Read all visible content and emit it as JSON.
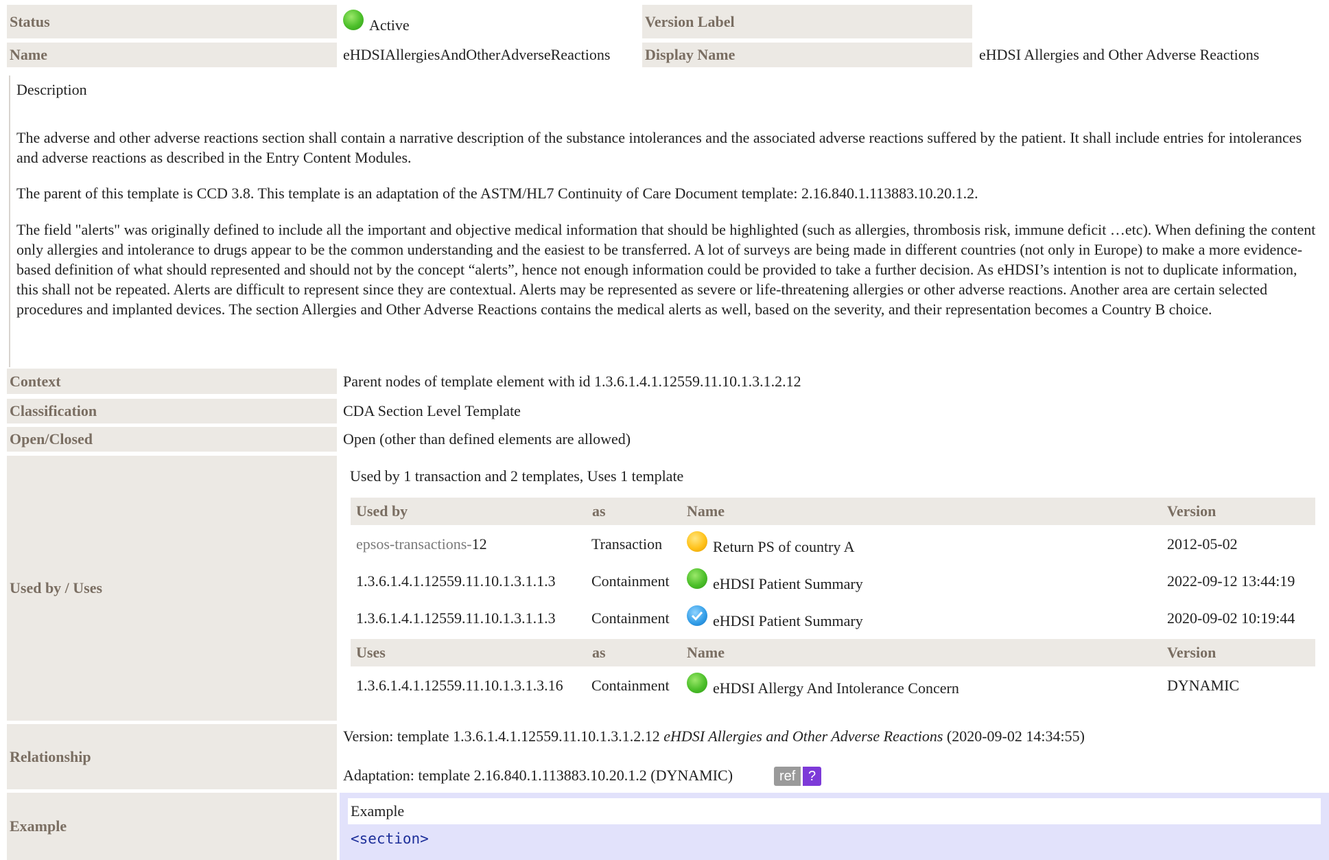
{
  "header": {
    "status_label": "Status",
    "status_value": "Active",
    "version_label_label": "Version Label",
    "version_label_value": "",
    "name_label": "Name",
    "name_value": "eHDSIAllergiesAndOtherAdverseReactions",
    "display_name_label": "Display Name",
    "display_name_value": "eHDSI Allergies and Other Adverse Reactions"
  },
  "description": {
    "title": "Description",
    "paragraphs": [
      "The adverse and other adverse reactions section shall contain a narrative description of the substance intolerances and the associated adverse reactions suffered by the patient. It shall include entries for intolerances and adverse reactions as described in the Entry Content Modules.",
      "The parent of this template is CCD 3.8. This template is an adaptation of the ASTM/HL7 Continuity of Care Document template: 2.16.840.1.113883.10.20.1.2.",
      "The field \"alerts\" was originally defined to include all the important and objective medical information that should be highlighted (such as allergies, thrombosis risk, immune deficit …etc). When defining the content only allergies and intolerance to drugs appear to be the common understanding and the easiest to be transferred. A lot of surveys are being made in different countries (not only in Europe) to make a more evidence-based definition of what should represented and should not by the concept “alerts”, hence not enough information could be provided to take a further decision. As eHDSI’s intention is not to duplicate information, this shall not be repeated. Alerts are difficult to represent since they are contextual. Alerts may be represented as severe or life-threatening allergies or other adverse reactions. Another area are certain selected procedures and implanted devices. The section Allergies and Other Adverse Reactions contains the medical alerts as well, based on the severity, and their representation becomes a Country B choice."
    ]
  },
  "context": {
    "label": "Context",
    "value": "Parent nodes of template element with id 1.3.6.1.4.1.12559.11.10.1.3.1.2.12"
  },
  "classification": {
    "label": "Classification",
    "value": "CDA Section Level Template"
  },
  "open_closed": {
    "label": "Open/Closed",
    "value": "Open (other than defined elements are allowed)"
  },
  "used_by_uses": {
    "label": "Used by / Uses",
    "summary": "Used by 1 transaction and 2 templates, Uses 1 template",
    "used_by_headers": [
      "Used by",
      "as",
      "Name",
      "Version"
    ],
    "used_by_rows": [
      {
        "id_prefix": "epsos-transactions-",
        "id_suffix": "12",
        "as": "Transaction",
        "status": "yellow",
        "name": "Return PS of country A",
        "version": "2012-05-02"
      },
      {
        "id": "1.3.6.1.4.1.12559.11.10.1.3.1.1.3",
        "as": "Containment",
        "status": "green",
        "name": "eHDSI Patient Summary",
        "version": "2022-09-12 13:44:19"
      },
      {
        "id": "1.3.6.1.4.1.12559.11.10.1.3.1.1.3",
        "as": "Containment",
        "status": "blue-check",
        "name": "eHDSI Patient Summary",
        "version": "2020-09-02 10:19:44"
      }
    ],
    "uses_headers": [
      "Uses",
      "as",
      "Name",
      "Version"
    ],
    "uses_rows": [
      {
        "id": "1.3.6.1.4.1.12559.11.10.1.3.1.3.16",
        "as": "Containment",
        "status": "green",
        "name": "eHDSI Allergy And Intolerance Concern",
        "version": "DYNAMIC"
      }
    ]
  },
  "relationship": {
    "label": "Relationship",
    "version_prefix": "Version: template 1.3.6.1.4.1.12559.11.10.1.3.1.2.12 ",
    "version_name": "eHDSI Allergies and Other Adverse Reactions",
    "version_suffix": " (2020-09-02 14:34:55)",
    "adaptation": "Adaptation: template 2.16.840.1.113883.10.20.1.2 (DYNAMIC)",
    "badge_ref": "ref",
    "badge_q": "?"
  },
  "example": {
    "label": "Example",
    "head": "Example",
    "code": "<section>"
  },
  "colors": {
    "label_bg": "#ece9e4",
    "label_text": "#7a6e62",
    "example_bg": "#e2e2fb",
    "badge_q": "#7d3ad8"
  }
}
